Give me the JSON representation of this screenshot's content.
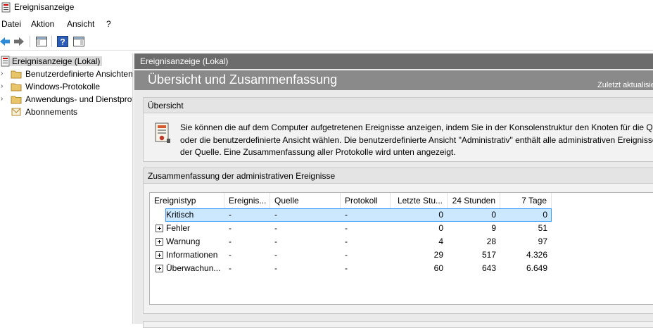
{
  "window": {
    "title": "Ereignisanzeige"
  },
  "menu": {
    "items": [
      "Datei",
      "Aktion",
      "Ansicht",
      "?"
    ]
  },
  "toolbar": {
    "buttons": [
      "back-arrow-icon",
      "forward-arrow-icon",
      "show-hide-console-tree-icon",
      "help-icon",
      "show-hide-action-pane-icon"
    ]
  },
  "tree": {
    "root": "Ereignisanzeige (Lokal)",
    "items": [
      {
        "label": "Benutzerdefinierte Ansichten",
        "expandable": true
      },
      {
        "label": "Windows-Protokolle",
        "expandable": true
      },
      {
        "label": "Anwendungs- und Dienstprotokolle",
        "expandable": true
      },
      {
        "label": "Abonnements",
        "expandable": false
      }
    ]
  },
  "pane": {
    "header": "Ereignisanzeige (Lokal)",
    "banner_title": "Übersicht und Zusammenfassung",
    "last_refresh": "Zuletzt aktualisiert"
  },
  "overview": {
    "heading": "Übersicht",
    "lines": [
      "Sie können die auf dem Computer aufgetretenen Ereignisse anzeigen, indem Sie in der Konsolenstruktur den Knoten für die Quelle",
      "oder die benutzerdefinierte Ansicht wählen. Die benutzerdefinierte Ansicht \"Administrativ\" enthält alle administrativen Ereignisse",
      "der Quelle. Eine Zusammenfassung aller Protokolle wird unten angezeigt."
    ]
  },
  "summary": {
    "heading": "Zusammenfassung der administrativen Ereignisse",
    "columns": [
      "Ereignistyp",
      "Ereignis...",
      "Quelle",
      "Protokoll",
      "Letzte Stu...",
      "24 Stunden",
      "7 Tage"
    ],
    "rows": [
      {
        "type": "Kritisch",
        "event_id": "-",
        "source": "-",
        "log": "-",
        "last_hour": "0",
        "h24": "0",
        "d7": "0",
        "expandable": false,
        "selected": true
      },
      {
        "type": "Fehler",
        "event_id": "-",
        "source": "-",
        "log": "-",
        "last_hour": "0",
        "h24": "9",
        "d7": "51",
        "expandable": true,
        "selected": false
      },
      {
        "type": "Warnung",
        "event_id": "-",
        "source": "-",
        "log": "-",
        "last_hour": "4",
        "h24": "28",
        "d7": "97",
        "expandable": true,
        "selected": false
      },
      {
        "type": "Informationen",
        "event_id": "-",
        "source": "-",
        "log": "-",
        "last_hour": "29",
        "h24": "517",
        "d7": "4.326",
        "expandable": true,
        "selected": false
      },
      {
        "type": "Überwachun...",
        "event_id": "-",
        "source": "-",
        "log": "-",
        "last_hour": "60",
        "h24": "643",
        "d7": "6.649",
        "expandable": true,
        "selected": false
      }
    ]
  },
  "colors": {
    "selection_fill": "#cce8ff",
    "selection_border": "#3399ff",
    "pane_header": "#6c6c6c",
    "banner": "#8a8a8a"
  }
}
